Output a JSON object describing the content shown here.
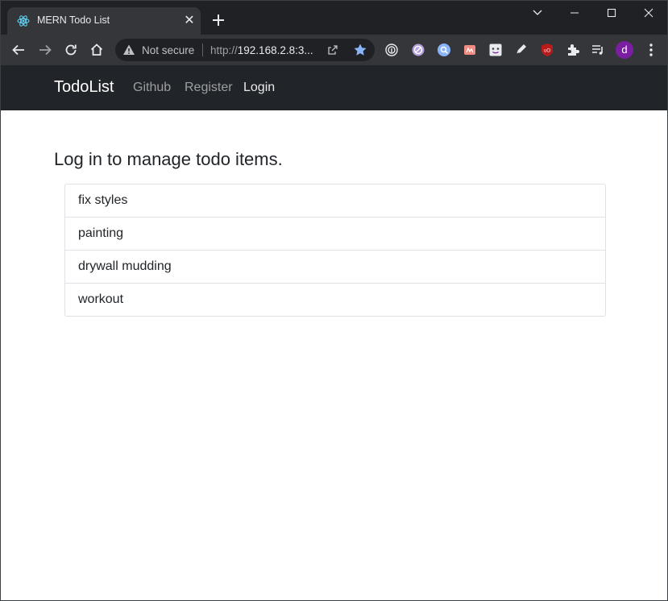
{
  "browser": {
    "tab": {
      "title": "MERN Todo List",
      "favicon": "react-atom-icon"
    },
    "omnibox": {
      "security_label": "Not secure",
      "url_scheme": "http://",
      "url_host": "192.168.2.8:3..."
    },
    "extensions": [
      "fingerprint-icon",
      "crossed-circle-icon",
      "search-ext-icon",
      "pdf-ext-icon",
      "face-ext-icon",
      "pen-ext-icon",
      "ublock-icon",
      "puzzle-icon",
      "media-queue-icon"
    ],
    "profile_initial": "d",
    "colors": {
      "frame": "#202124",
      "toolbar": "#35363a",
      "star": "#8ab4f8",
      "avatar": "#7b1fa2"
    }
  },
  "navbar": {
    "brand": "TodoList",
    "links": [
      {
        "label": "Github",
        "active": false
      },
      {
        "label": "Register",
        "active": false
      },
      {
        "label": "Login",
        "active": true
      }
    ]
  },
  "main": {
    "heading": "Log in to manage todo items.",
    "todos": [
      "fix styles",
      "painting",
      "drywall mudding",
      "workout"
    ]
  }
}
